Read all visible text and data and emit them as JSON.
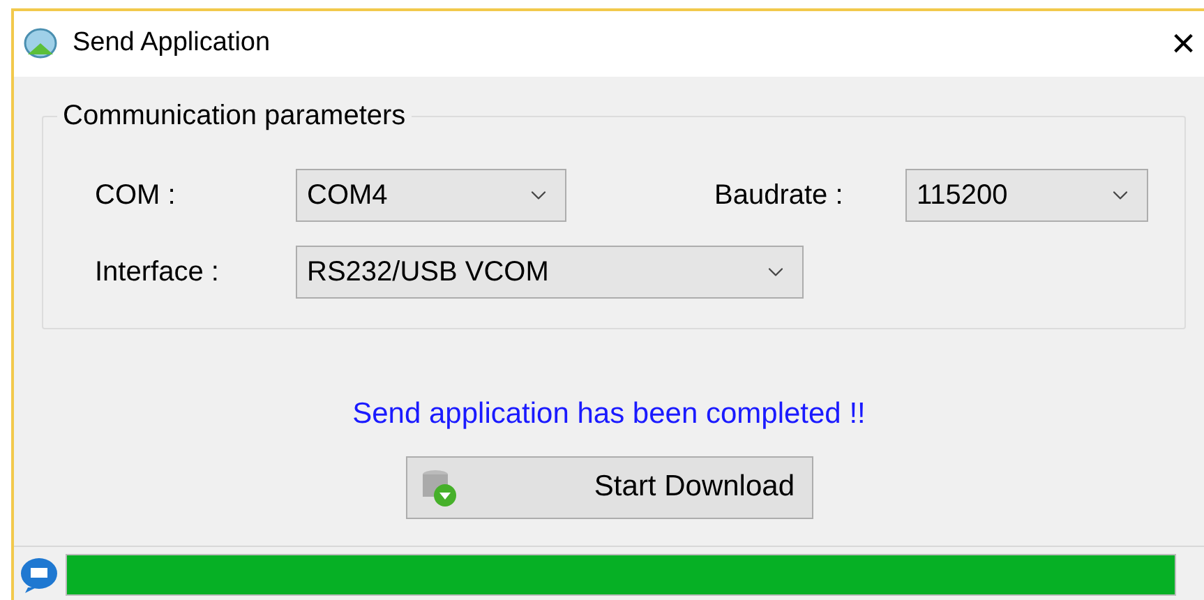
{
  "window": {
    "title": "Send Application",
    "close": "×"
  },
  "group": {
    "title": "Communication parameters",
    "fields": [
      {
        "label": "COM :",
        "value": "COM4"
      },
      {
        "label": "Baudrate :",
        "value": "115200"
      },
      {
        "label": "Interface :",
        "value": "RS232/USB VCOM"
      }
    ]
  },
  "message": "Send application has been completed !!",
  "button": "Start Download",
  "progress": {
    "level": 1.0
  }
}
